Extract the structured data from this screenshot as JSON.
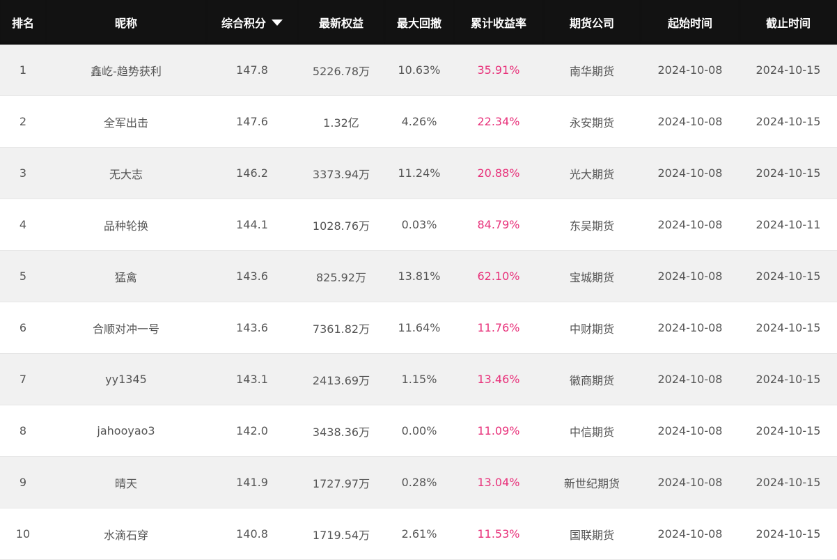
{
  "table": {
    "headers": [
      {
        "key": "rank",
        "label": "排名"
      },
      {
        "key": "nickname",
        "label": "昵称"
      },
      {
        "key": "score",
        "label": "综合积分"
      },
      {
        "key": "equity",
        "label": "最新权益"
      },
      {
        "key": "drawdown",
        "label": "最大回撤"
      },
      {
        "key": "return",
        "label": "累计收益率"
      },
      {
        "key": "company",
        "label": "期货公司"
      },
      {
        "key": "start",
        "label": "起始时间"
      },
      {
        "key": "end",
        "label": "截止时间"
      }
    ],
    "sort_column": "score",
    "sort_direction": "desc",
    "rows": [
      {
        "rank": "1",
        "nickname": "鑫屹-趋势获利",
        "score": "147.8",
        "equity": "5226.78万",
        "drawdown": "10.63%",
        "return": "35.91%",
        "company": "南华期货",
        "start": "2024-10-08",
        "end": "2024-10-15"
      },
      {
        "rank": "2",
        "nickname": "全军出击",
        "score": "147.6",
        "equity": "1.32亿",
        "drawdown": "4.26%",
        "return": "22.34%",
        "company": "永安期货",
        "start": "2024-10-08",
        "end": "2024-10-15"
      },
      {
        "rank": "3",
        "nickname": "无大志",
        "score": "146.2",
        "equity": "3373.94万",
        "drawdown": "11.24%",
        "return": "20.88%",
        "company": "光大期货",
        "start": "2024-10-08",
        "end": "2024-10-15"
      },
      {
        "rank": "4",
        "nickname": "品种轮换",
        "score": "144.1",
        "equity": "1028.76万",
        "drawdown": "0.03%",
        "return": "84.79%",
        "company": "东吴期货",
        "start": "2024-10-08",
        "end": "2024-10-11"
      },
      {
        "rank": "5",
        "nickname": "猛禽",
        "score": "143.6",
        "equity": "825.92万",
        "drawdown": "13.81%",
        "return": "62.10%",
        "company": "宝城期货",
        "start": "2024-10-08",
        "end": "2024-10-15"
      },
      {
        "rank": "6",
        "nickname": "合顺对冲一号",
        "score": "143.6",
        "equity": "7361.82万",
        "drawdown": "11.64%",
        "return": "11.76%",
        "company": "中财期货",
        "start": "2024-10-08",
        "end": "2024-10-15"
      },
      {
        "rank": "7",
        "nickname": "yy1345",
        "score": "143.1",
        "equity": "2413.69万",
        "drawdown": "1.15%",
        "return": "13.46%",
        "company": "徽商期货",
        "start": "2024-10-08",
        "end": "2024-10-15"
      },
      {
        "rank": "8",
        "nickname": "jahooyao3",
        "score": "142.0",
        "equity": "3438.36万",
        "drawdown": "0.00%",
        "return": "11.09%",
        "company": "中信期货",
        "start": "2024-10-08",
        "end": "2024-10-15"
      },
      {
        "rank": "9",
        "nickname": "晴天",
        "score": "141.9",
        "equity": "1727.97万",
        "drawdown": "0.28%",
        "return": "13.04%",
        "company": "新世纪期货",
        "start": "2024-10-08",
        "end": "2024-10-15"
      },
      {
        "rank": "10",
        "nickname": "水滴石穿",
        "score": "140.8",
        "equity": "1719.54万",
        "drawdown": "2.61%",
        "return": "11.53%",
        "company": "国联期货",
        "start": "2024-10-08",
        "end": "2024-10-15"
      }
    ]
  },
  "colors": {
    "header_bg": "#121212",
    "header_text": "#ffffff",
    "row_alt_bg": "#f1f1f1",
    "text": "#555555",
    "return_accent": "#e8317a"
  },
  "icons": {
    "sort": "caret-down-icon"
  }
}
